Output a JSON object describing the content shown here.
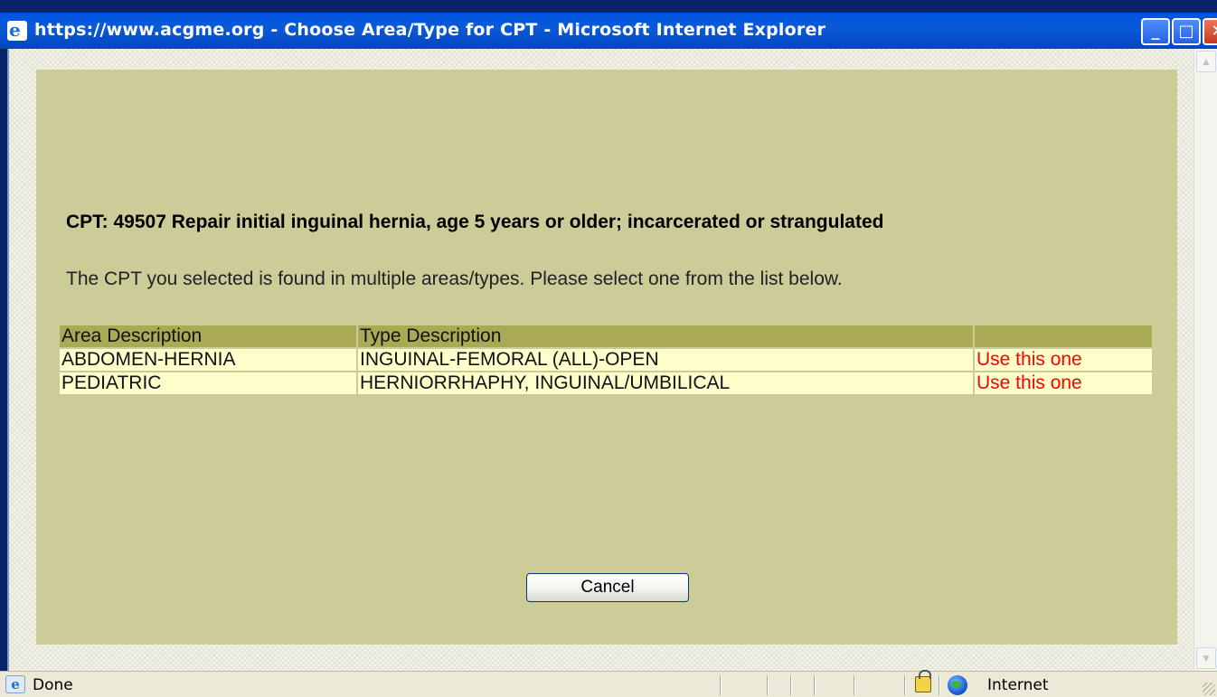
{
  "window": {
    "title": "https://www.acgme.org - Choose Area/Type for CPT - Microsoft Internet Explorer",
    "controls": {
      "minimize": "_",
      "maximize": "□",
      "close": "✕"
    }
  },
  "dialog": {
    "cpt_title": "CPT: 49507 Repair initial inguinal hernia, age 5 years or older; incarcerated or strangulated",
    "instructions": "The CPT you selected is found in multiple areas/types. Please select one from the list below.",
    "table": {
      "headers": [
        "Area Description",
        "Type Description",
        ""
      ],
      "rows": [
        {
          "area": "ABDOMEN-HERNIA",
          "type": "INGUINAL-FEMORAL (ALL)-OPEN",
          "action": "Use this one"
        },
        {
          "area": "PEDIATRIC",
          "type": "HERNIORRHAPHY, INGUINAL/UMBILICAL",
          "action": "Use this one"
        }
      ]
    },
    "cancel_label": "Cancel"
  },
  "statusbar": {
    "status": "Done",
    "zone": "Internet"
  },
  "colors": {
    "panel": "#cccc99",
    "header_cell": "#aaaa55",
    "data_cell": "#ffffcc",
    "link": "#ff0000"
  }
}
